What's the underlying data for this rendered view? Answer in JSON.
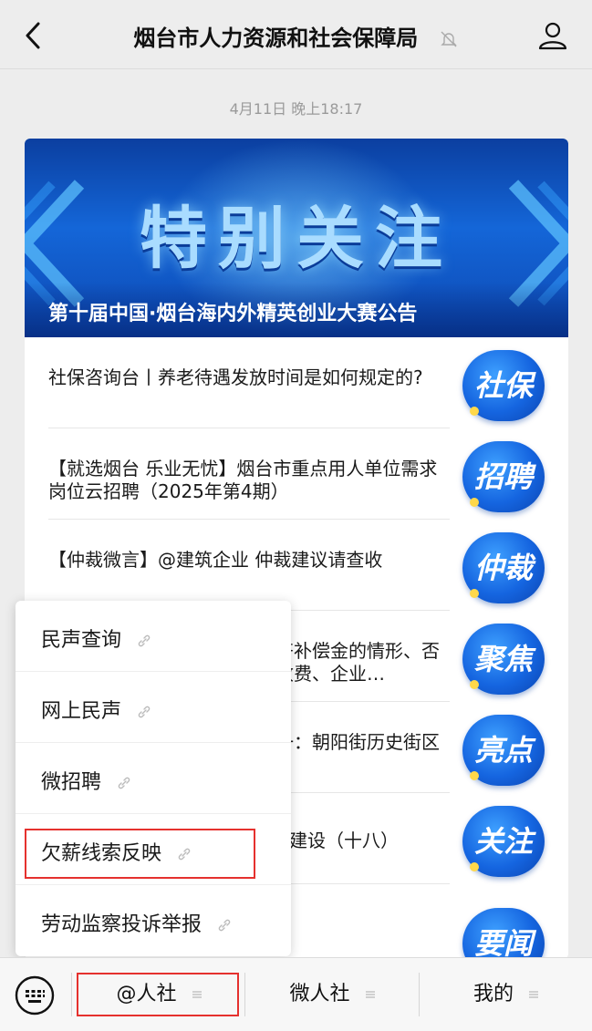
{
  "header": {
    "title": "烟台市人力资源和社会保障局"
  },
  "timestamp": "4月11日 晚上18:17",
  "article": {
    "banner_headline": "特别关注",
    "banner_caption": "第十届中国·烟台海内外精英创业大赛公告",
    "items": [
      {
        "text": "社保咨询台丨养老待遇发放时间是如何规定的?",
        "thumb": "社保"
      },
      {
        "text": "【就选烟台 乐业无忧】烟台市重点用人单位需求岗位云招聘（2025年第4期）",
        "thumb": "招聘"
      },
      {
        "text": "【仲裁微言】@建筑企业  仲裁建议请查收",
        "thumb": "仲裁"
      },
      {
        "text": "齐补偿金的情形、否收费、企业…",
        "thumb": "聚焦"
      },
      {
        "text": "一：朝阳街历史街区",
        "thumb": "亮点"
      },
      {
        "text": "建设（十八）",
        "thumb": "关注"
      },
      {
        "text": "",
        "thumb": "要闻"
      }
    ]
  },
  "menu": {
    "items": [
      {
        "label": "民声查询"
      },
      {
        "label": "网上民声"
      },
      {
        "label": "微招聘"
      },
      {
        "label": "欠薪线索反映"
      },
      {
        "label": "劳动监察投诉举报"
      }
    ]
  },
  "bottom_bar": {
    "tabs": [
      {
        "label": "@人社"
      },
      {
        "label": "微人社"
      },
      {
        "label": "我的"
      }
    ]
  },
  "colors": {
    "highlight": "#e5312e",
    "brand_blue": "#1565e0"
  }
}
